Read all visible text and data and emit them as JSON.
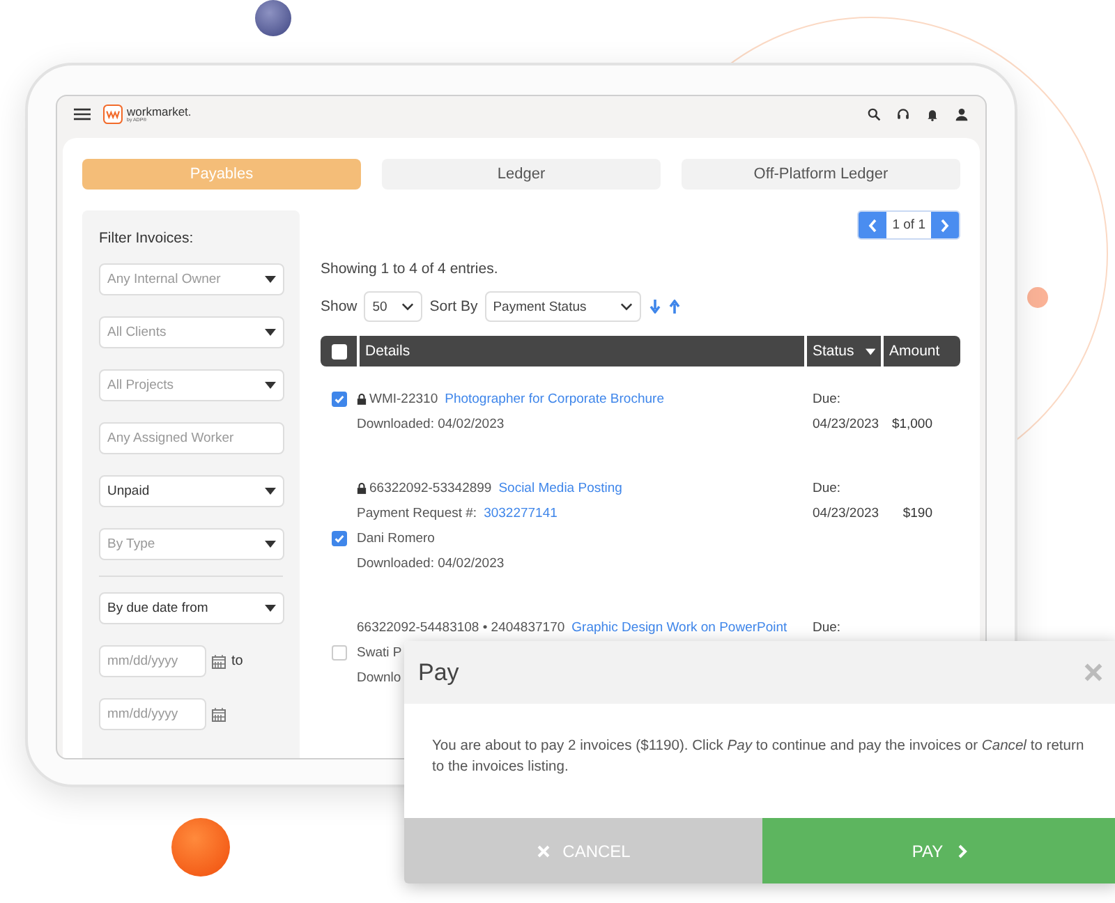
{
  "app": {
    "logo": "workmarket.",
    "logo_sub": "by ADP®"
  },
  "tabs": [
    {
      "label": "Payables",
      "selected": true
    },
    {
      "label": "Ledger",
      "selected": false
    },
    {
      "label": "Off-Platform Ledger",
      "selected": false
    }
  ],
  "filters": {
    "title": "Filter Invoices:",
    "items": [
      {
        "kind": "select",
        "placeholder": "Any Internal Owner"
      },
      {
        "kind": "select",
        "placeholder": "All Clients"
      },
      {
        "kind": "select",
        "placeholder": "All Projects"
      },
      {
        "kind": "input",
        "placeholder": "Any Assigned Worker"
      },
      {
        "kind": "select",
        "value": "Unpaid"
      },
      {
        "kind": "select",
        "placeholder": "By Type"
      },
      {
        "kind": "divider"
      },
      {
        "kind": "select",
        "value": "By due date from"
      },
      {
        "kind": "date",
        "placeholder": "mm/dd/yyyy",
        "suffix": "to"
      },
      {
        "kind": "date",
        "placeholder": "mm/dd/yyyy"
      }
    ]
  },
  "pager": {
    "label": "1 of 1"
  },
  "summary": "Showing 1 to 4 of 4 entries.",
  "show": {
    "label": "Show",
    "value": "50"
  },
  "sort": {
    "label": "Sort By",
    "value": "Payment Status"
  },
  "table": {
    "select_all": {
      "checked": false
    },
    "columns": [
      "Details",
      "Status",
      "Amount"
    ],
    "rows": [
      {
        "status_label": "Due:",
        "due": "04/23/2023",
        "amount": "$1,000",
        "lines": [
          {
            "locked": true,
            "checked": true,
            "parts": [
              {
                "text": "WMI-22310",
                "link": false
              },
              {
                "text": "Photographer for Corporate Brochure",
                "link": true
              }
            ]
          },
          {
            "parts": [
              {
                "text": "Downloaded: 04/02/2023",
                "link": false
              }
            ]
          }
        ]
      },
      {
        "status_label": "Due:",
        "due": "04/23/2023",
        "amount": "$190",
        "lines": [
          {
            "locked": true,
            "parts": [
              {
                "text": "66322092-53342899",
                "link": false
              },
              {
                "text": "Social Media Posting",
                "link": true
              }
            ]
          },
          {
            "parts": [
              {
                "text": "Payment Request #:",
                "link": false
              },
              {
                "text": "3032277141",
                "link": true
              }
            ]
          },
          {
            "checked": true,
            "parts": [
              {
                "text": "Dani Romero",
                "link": false
              }
            ]
          },
          {
            "parts": [
              {
                "text": "Downloaded: 04/02/2023",
                "link": false
              }
            ]
          }
        ]
      },
      {
        "status_label": "Due:",
        "lines": [
          {
            "parts": [
              {
                "text": "66322092-54483108 • 2404837170",
                "link": false
              },
              {
                "text": "Graphic Design Work on PowerPoint",
                "link": true
              }
            ]
          },
          {
            "checked": false,
            "parts": [
              {
                "text": "Swati P",
                "link": false
              }
            ]
          },
          {
            "parts": [
              {
                "text": "Downlo",
                "link": false
              }
            ]
          }
        ]
      }
    ]
  },
  "dialog": {
    "title": "Pay",
    "message": "You are about to pay 2 invoices ($1190). Click *Pay* to continue and pay the invoices or *Cancel* to return to the invoices listing.",
    "cancel": "CANCEL",
    "confirm": "PAY"
  }
}
